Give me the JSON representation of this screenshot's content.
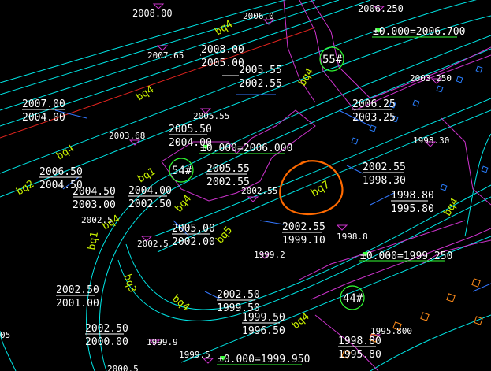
{
  "colors": {
    "background": "#000000",
    "road_line": "#00e5e5",
    "boundary": "#cc33cc",
    "leader": "#3377ff",
    "text": "#ffffff",
    "road_code": "#c8f000",
    "building_id": "#33ff33",
    "markup_circle": "#ff6a00",
    "red_line": "#e0241e",
    "marker_blue": "#2a7fff",
    "marker_orange": "#ff8c1a"
  },
  "top_labels": [
    "2008.00",
    "2006.0",
    "2006.250"
  ],
  "elevation_pairs": [
    {
      "top": "2008.00",
      "bottom": "2005.00"
    },
    {
      "top": "2005.55",
      "bottom": "2002.55"
    },
    {
      "top": "2007.00",
      "bottom": "2004.00"
    },
    {
      "top": "2006.25",
      "bottom": "2003.25"
    },
    {
      "top": "2005.50",
      "bottom": "2004.00"
    },
    {
      "top": "2006.50",
      "bottom": "2004.50"
    },
    {
      "top": "2005.55",
      "bottom": "2002.55"
    },
    {
      "top": "2002.55",
      "bottom": "1998.30"
    },
    {
      "top": "2004.50",
      "bottom": "2003.00"
    },
    {
      "top": "2004.00",
      "bottom": "2002.50"
    },
    {
      "top": "1998.80",
      "bottom": "1995.80"
    },
    {
      "top": "2005.00",
      "bottom": "2002.00"
    },
    {
      "top": "2002.55",
      "bottom": "1999.10"
    },
    {
      "top": "2002.50",
      "bottom": "2001.00"
    },
    {
      "top": "2002.50",
      "bottom": "1999.50"
    },
    {
      "top": "1999.50",
      "bottom": "1996.50"
    },
    {
      "top": "2002.50",
      "bottom": "2000.00"
    },
    {
      "top": "1998.80",
      "bottom": "1995.80"
    }
  ],
  "spot_elevations": [
    "2007.65",
    "2003.250",
    "2005.55",
    "2003.68",
    "1998.30",
    "2002.55",
    "2002.5",
    "1998.8",
    "2002.5",
    "1999.2",
    "1995.800",
    "1999.9",
    "1999.5",
    "2000.5",
    "05"
  ],
  "floor_levels": [
    "±0.000=2006.700",
    "±0.000=2006.000",
    "±0.000=1999.250",
    "±0.000=1999.950"
  ],
  "road_codes": [
    "bq4",
    "bq4",
    "bq4",
    "bq4",
    "bq2",
    "bq1",
    "bq7",
    "bq4",
    "bq4",
    "bq1",
    "bq5",
    "bq3",
    "bq4",
    "bq4",
    "bq4"
  ],
  "buildings": [
    "55#",
    "54#",
    "44#"
  ]
}
